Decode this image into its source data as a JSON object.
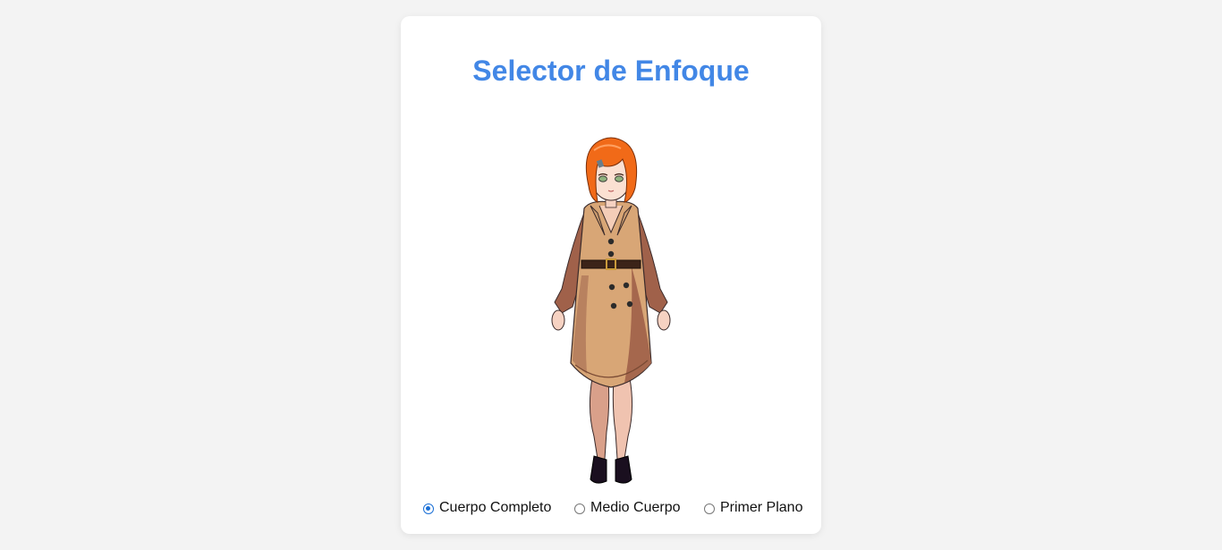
{
  "page": {
    "title": "Selector de Enfoque"
  },
  "focus_options": {
    "selected": "Cuerpo Completo",
    "items": [
      {
        "label": "Cuerpo Completo",
        "checked": true
      },
      {
        "label": "Medio Cuerpo",
        "checked": false
      },
      {
        "label": "Primer Plano",
        "checked": false
      }
    ]
  },
  "colors": {
    "title": "#4287e6",
    "background": "#f3f3f3",
    "card": "#ffffff",
    "radio_selected": "#1a6fd6"
  }
}
